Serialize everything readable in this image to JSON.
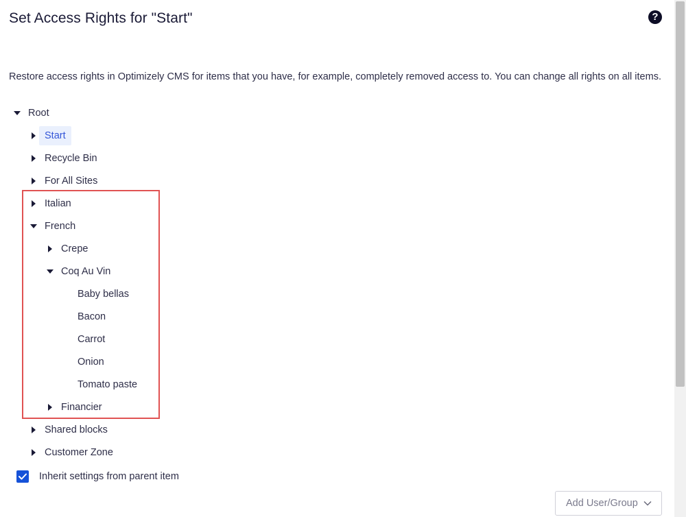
{
  "dialog": {
    "title": "Set Access Rights for \"Start\"",
    "help_symbol": "?",
    "description": "Restore access rights in Optimizely CMS for items that you have, for example, completely removed access to. You can change all rights on all items."
  },
  "tree": {
    "root": "Root",
    "start": "Start",
    "recycle_bin": "Recycle Bin",
    "for_all_sites": "For All Sites",
    "italian": "Italian",
    "french": "French",
    "crepe": "Crepe",
    "coq_au_vin": "Coq Au Vin",
    "baby_bellas": "Baby bellas",
    "bacon": "Bacon",
    "carrot": "Carrot",
    "onion": "Onion",
    "tomato_paste": "Tomato paste",
    "financier": "Financier",
    "shared_blocks": "Shared blocks",
    "customer_zone": "Customer Zone"
  },
  "inherit": {
    "label": "Inherit settings from parent item",
    "checked": true
  },
  "add_button": {
    "label": "Add User/Group"
  },
  "colors": {
    "selected_bg": "#eaf0fd",
    "selected_text": "#3456d8",
    "highlight_border": "#e05252",
    "checkbox": "#1652d8"
  },
  "icons": {
    "expanded": "caret-down-icon",
    "collapsed": "caret-right-icon",
    "help": "question-circle-icon",
    "check": "check-icon",
    "dropdown": "chevron-down-icon"
  }
}
